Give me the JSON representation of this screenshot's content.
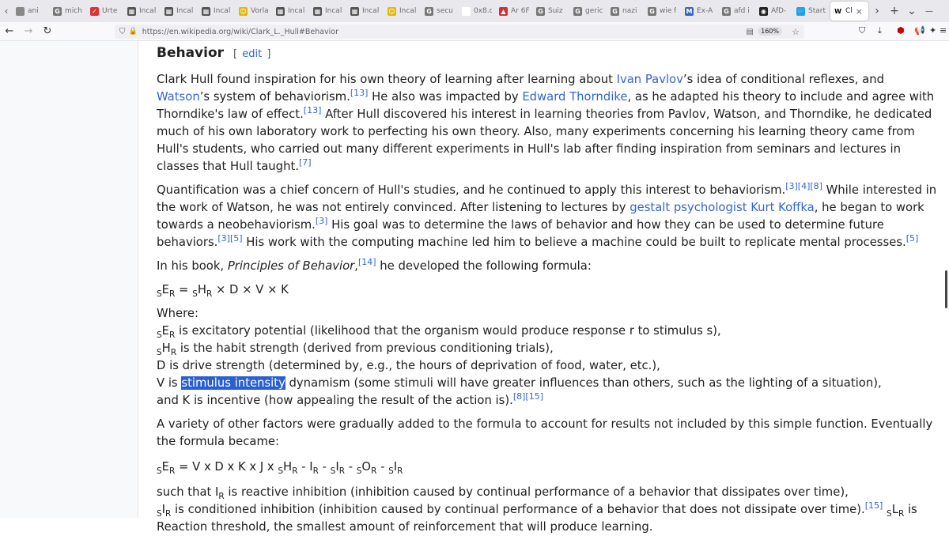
{
  "browser": {
    "tabs": [
      {
        "label": "ani",
        "fav": "#888",
        "glyph": ""
      },
      {
        "label": "mich",
        "fav": "#777",
        "glyph": "G"
      },
      {
        "label": "Urte",
        "fav": "#d33",
        "glyph": "✓"
      },
      {
        "label": "Incal",
        "fav": "#555",
        "glyph": "▦"
      },
      {
        "label": "Incal",
        "fav": "#555",
        "glyph": "▦"
      },
      {
        "label": "Incal",
        "fav": "#555",
        "glyph": "▦"
      },
      {
        "label": "Vorla",
        "fav": "#e6b800",
        "glyph": "☺"
      },
      {
        "label": "Incal",
        "fav": "#555",
        "glyph": "▦"
      },
      {
        "label": "Incal",
        "fav": "#555",
        "glyph": "▦"
      },
      {
        "label": "Incal",
        "fav": "#555",
        "glyph": "▦"
      },
      {
        "label": "Incal",
        "fav": "#e6b800",
        "glyph": "☺"
      },
      {
        "label": "secu",
        "fav": "#777",
        "glyph": "G"
      },
      {
        "label": "0x8.ch/",
        "fav": "#fff",
        "glyph": ""
      },
      {
        "label": "Ar 6F",
        "fav": "#c33",
        "glyph": "▲"
      },
      {
        "label": "Suiz",
        "fav": "#777",
        "glyph": "G"
      },
      {
        "label": "geric",
        "fav": "#777",
        "glyph": "G"
      },
      {
        "label": "nazi",
        "fav": "#777",
        "glyph": "G"
      },
      {
        "label": "wie f",
        "fav": "#777",
        "glyph": "G"
      },
      {
        "label": "Ex-A",
        "fav": "#36c",
        "glyph": "M"
      },
      {
        "label": "afd i",
        "fav": "#777",
        "glyph": "G"
      },
      {
        "label": "AfD-",
        "fav": "#222",
        "glyph": "◉"
      },
      {
        "label": "Start",
        "fav": "#1da1f2",
        "glyph": "🐦"
      },
      {
        "label": "Cl",
        "fav": "#fff",
        "glyph": "W",
        "active": true
      }
    ],
    "url": "https://en.wikipedia.org/wiki/Clark_L._Hull#Behavior",
    "zoom": "160%",
    "new_tab": "+",
    "list_all": "⌄",
    "minimize": "—"
  },
  "article": {
    "heading": "Behavior",
    "edit_open": "[",
    "edit_label": "edit",
    "edit_close": "]",
    "p1": {
      "t1": "Clark Hull found inspiration for his own theory of learning after learning about ",
      "l1": "Ivan Pavlov",
      "t2": "’s idea of conditional reflexes, and ",
      "l2": "Watson",
      "t3": "’s system of behaviorism.",
      "r1": "[13]",
      "t4": " He also was impacted by ",
      "l3": "Edward Thorndike",
      "t5": ", as he adapted his theory to include and agree with Thorndike's law of effect.",
      "r2": "[13]",
      "t6": " After Hull discovered his interest in learning theories from Pavlov, Watson, and Thorndike, he dedicated much of his own laboratory work to perfecting his own theory. Also, many experiments concerning his learning theory came from Hull's students, who carried out many different experiments in Hull's lab after finding inspiration from seminars and lectures in classes that Hull taught.",
      "r3": "[7]"
    },
    "p2": {
      "t1": "Quantification was a chief concern of Hull's studies, and he continued to apply this interest to behaviorism.",
      "r1": "[3][4][8]",
      "t2": " While interested in the work of Watson, he was not entirely convinced. After listening to lectures by ",
      "l1": "gestalt psychologist Kurt Koffka",
      "t3": ", he began to work towards a neobehaviorism.",
      "r2": "[3]",
      "t4": " His goal was to determine the laws of behavior and how they can be used to determine future behaviors.",
      "r3": "[3][5]",
      "t5": " His work with the computing machine led him to believe a machine could be built to replicate mental processes.",
      "r4": "[5]"
    },
    "p3": {
      "t1": "In his book, ",
      "book": "Principles of Behavior",
      "t2": ",",
      "r1": "[14]",
      "t3": " he developed the following formula:"
    },
    "formula1": {
      "s1": "S",
      "a": "E",
      "s2": "R",
      "eq": " = ",
      "s3": "S",
      "b": "H",
      "s4": "R",
      "rest": " × D × V × K"
    },
    "where": {
      "head": "Where:",
      "l1a": "S",
      "l1b": "E",
      "l1c": "R",
      "l1d": " is excitatory potential (likelihood that the organism would produce response r to stimulus s),",
      "l2a": "S",
      "l2b": "H",
      "l2c": "R",
      "l2d": " is the habit strength (derived from previous conditioning trials),",
      "l3": "D is drive strength (determined by, e.g., the hours of deprivation of food, water, etc.),",
      "l4a": "V is ",
      "l4sel": "stimulus intensity",
      "l4b": " dynamism (some stimuli will have greater influences than others, such as the lighting of a situation),",
      "l5": "and K is incentive (how appealing the result of the action is).",
      "l5r": "[8][15]"
    },
    "p4": "A variety of other factors were gradually added to the formula to account for results not included by this simple function. Eventually the formula became:",
    "formula2": {
      "a": "S",
      "b": "E",
      "c": "R",
      "d": " = V x D x K x J x ",
      "e": "S",
      "f": "H",
      "g": "R",
      "h": " - I",
      "i": "R",
      "j": " - ",
      "k": "S",
      "l": "I",
      "m": "R",
      "n": " - ",
      "o": "S",
      "p": "O",
      "q": "R",
      "r": " - ",
      "s": "S",
      "t": "I",
      "u": "R"
    },
    "p5": {
      "t1": "such that I",
      "s1": "R",
      "t2": " is reactive inhibition (inhibition caused by continual performance of a behavior that dissipates over time),",
      "s2": "S",
      "t3": "I",
      "s3": "R",
      "t4": " is conditioned inhibition (inhibition caused by continual performance of a behavior that does not dissipate over time).",
      "r1": "[15]",
      "t5": " ",
      "s4": "S",
      "t6": "L",
      "s5": "R",
      "t7": " is Reaction threshold, the smallest amount of reinforcement that will produce learning."
    }
  }
}
